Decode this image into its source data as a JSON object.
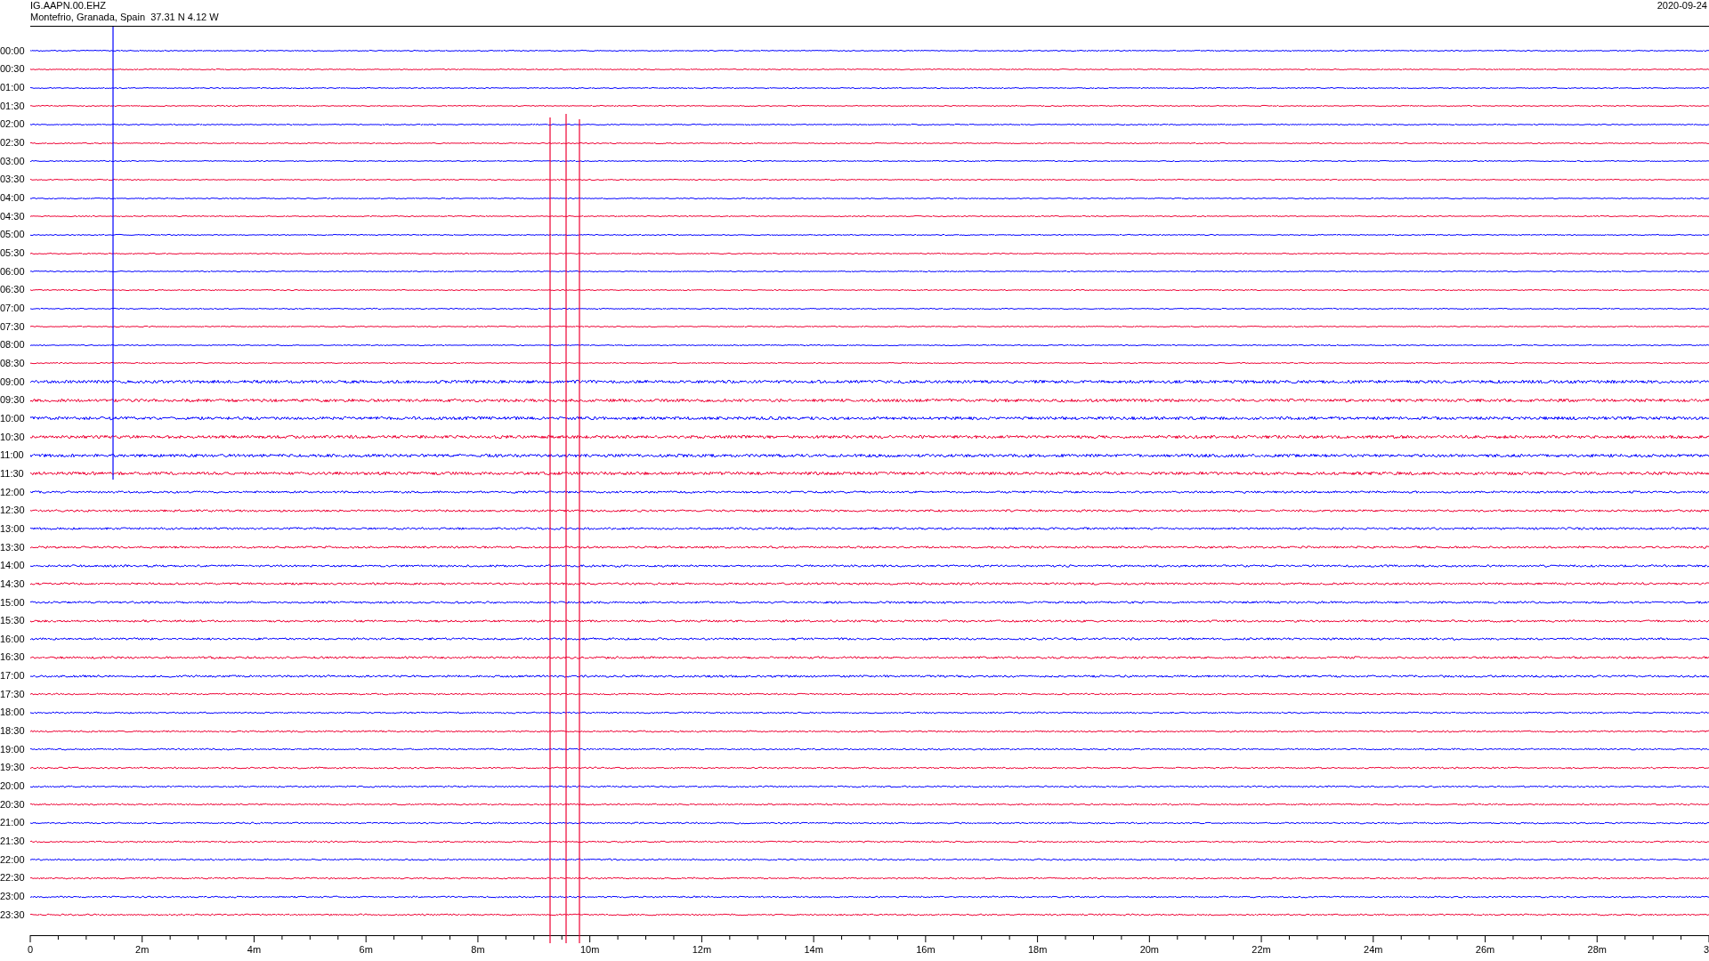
{
  "header": {
    "station": "IG.AAPN.00.EHZ",
    "location": "Montefrio, Granada, Spain  37.31 N 4.12 W",
    "date": "2020-09-24"
  },
  "rows": [
    {
      "label": "00:00",
      "color": "#0000ff"
    },
    {
      "label": "00:30",
      "color": "#ee0033"
    },
    {
      "label": "01:00",
      "color": "#0000ff"
    },
    {
      "label": "01:30",
      "color": "#ee0033"
    },
    {
      "label": "02:00",
      "color": "#0000ff"
    },
    {
      "label": "02:30",
      "color": "#ee0033"
    },
    {
      "label": "03:00",
      "color": "#0000ff"
    },
    {
      "label": "03:30",
      "color": "#ee0033"
    },
    {
      "label": "04:00",
      "color": "#0000ff"
    },
    {
      "label": "04:30",
      "color": "#ee0033"
    },
    {
      "label": "05:00",
      "color": "#0000ff"
    },
    {
      "label": "05:30",
      "color": "#ee0033"
    },
    {
      "label": "06:00",
      "color": "#0000ff"
    },
    {
      "label": "06:30",
      "color": "#ee0033"
    },
    {
      "label": "07:00",
      "color": "#0000ff"
    },
    {
      "label": "07:30",
      "color": "#ee0033"
    },
    {
      "label": "08:00",
      "color": "#0000ff"
    },
    {
      "label": "08:30",
      "color": "#ee0033"
    },
    {
      "label": "09:00",
      "color": "#0000ff"
    },
    {
      "label": "09:30",
      "color": "#ee0033"
    },
    {
      "label": "10:00",
      "color": "#0000ff"
    },
    {
      "label": "10:30",
      "color": "#ee0033"
    },
    {
      "label": "11:00",
      "color": "#0000ff"
    },
    {
      "label": "11:30",
      "color": "#ee0033"
    },
    {
      "label": "12:00",
      "color": "#0000ff"
    },
    {
      "label": "12:30",
      "color": "#ee0033"
    },
    {
      "label": "13:00",
      "color": "#0000ff"
    },
    {
      "label": "13:30",
      "color": "#ee0033"
    },
    {
      "label": "14:00",
      "color": "#0000ff"
    },
    {
      "label": "14:30",
      "color": "#ee0033"
    },
    {
      "label": "15:00",
      "color": "#0000ff"
    },
    {
      "label": "15:30",
      "color": "#ee0033"
    },
    {
      "label": "16:00",
      "color": "#0000ff"
    },
    {
      "label": "16:30",
      "color": "#ee0033"
    },
    {
      "label": "17:00",
      "color": "#0000ff"
    },
    {
      "label": "17:30",
      "color": "#ee0033"
    },
    {
      "label": "18:00",
      "color": "#0000ff"
    },
    {
      "label": "18:30",
      "color": "#ee0033"
    },
    {
      "label": "19:00",
      "color": "#0000ff"
    },
    {
      "label": "19:30",
      "color": "#ee0033"
    },
    {
      "label": "20:00",
      "color": "#0000ff"
    },
    {
      "label": "20:30",
      "color": "#ee0033"
    },
    {
      "label": "21:00",
      "color": "#0000ff"
    },
    {
      "label": "21:30",
      "color": "#ee0033"
    },
    {
      "label": "22:00",
      "color": "#0000ff"
    },
    {
      "label": "22:30",
      "color": "#ee0033"
    },
    {
      "label": "23:00",
      "color": "#0000ff"
    },
    {
      "label": "23:30",
      "color": "#ee0033"
    }
  ],
  "x_axis": {
    "labels": [
      "0",
      "2m",
      "4m",
      "6m",
      "8m",
      "10m",
      "12m",
      "14m",
      "16m",
      "18m",
      "20m",
      "22m",
      "24m",
      "26m",
      "28m",
      "3"
    ]
  }
}
